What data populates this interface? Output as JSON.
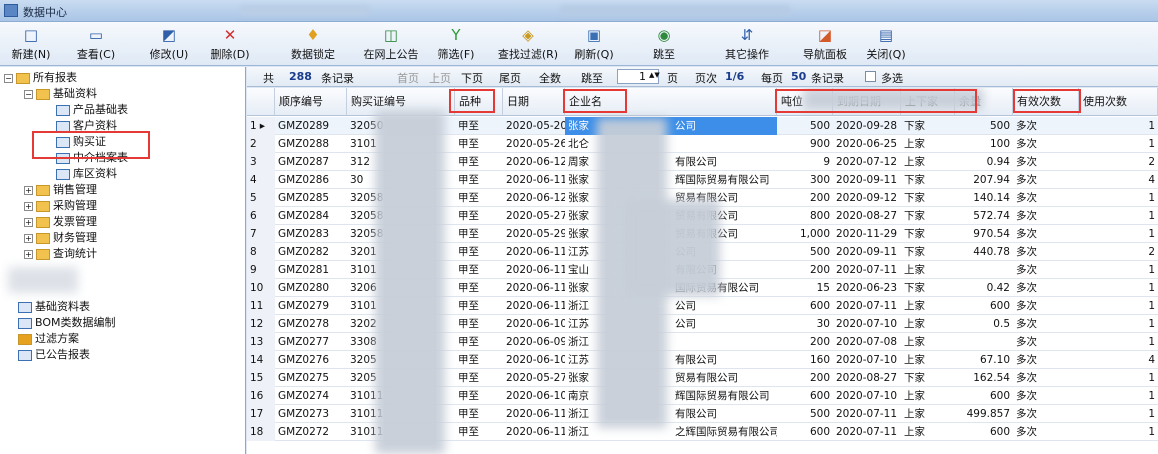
{
  "window": {
    "title": "数据中心"
  },
  "toolbar": [
    {
      "label": "新建(N)",
      "icon": "new-doc-icon",
      "glyph": "□",
      "color": "#2f5fa8"
    },
    {
      "label": "查看(C)",
      "icon": "view-icon",
      "glyph": "▭",
      "color": "#2f5fa8"
    },
    {
      "label": "修改(U)",
      "icon": "edit-icon",
      "glyph": "◩",
      "color": "#2f5fa8"
    },
    {
      "label": "删除(D)",
      "icon": "delete-icon",
      "glyph": "✕",
      "color": "#d32f2f"
    },
    {
      "label": "数据锁定",
      "icon": "lock-icon",
      "glyph": "♦",
      "color": "#e0a020"
    },
    {
      "label": "在网上公告",
      "icon": "publish-icon",
      "glyph": "◫",
      "color": "#2e8b3d"
    },
    {
      "label": "筛选(F)",
      "icon": "filter-icon",
      "glyph": "Y",
      "color": "#2e9b3a"
    },
    {
      "label": "查找过滤(R)",
      "icon": "search-filter-icon",
      "glyph": "◈",
      "color": "#c99a22"
    },
    {
      "label": "刷新(Q)",
      "icon": "refresh-icon",
      "glyph": "▣",
      "color": "#3a6fb4"
    },
    {
      "label": "跳至",
      "icon": "jump-icon",
      "glyph": "◉",
      "color": "#2e8b3d"
    },
    {
      "label": "其它操作",
      "icon": "other-ops-icon",
      "glyph": "⇵",
      "color": "#2f5fa8"
    },
    {
      "label": "导航面板",
      "icon": "nav-panel-icon",
      "glyph": "◪",
      "color": "#d35a2a"
    },
    {
      "label": "关闭(Q)",
      "icon": "close-icon",
      "glyph": "▤",
      "color": "#2f5fa8"
    }
  ],
  "tree": {
    "root": "所有报表",
    "basic": "基础资料",
    "basic_items": [
      "产品基础表",
      "客户资料",
      "购买证",
      "中介档案表",
      "库区资料"
    ],
    "groups": [
      "销售管理",
      "采购管理",
      "发票管理",
      "财务管理",
      "查询统计"
    ],
    "extra": [
      "基础资料表",
      "BOM类数据编制",
      "过滤方案",
      "已公告报表"
    ]
  },
  "grid_toolbar": {
    "count_prefix": "共",
    "count": "288",
    "count_suffix": "条记录",
    "first": "首页",
    "prev": "上页",
    "next": "下页",
    "last": "尾页",
    "all": "全数",
    "jump": "跳至",
    "page_input": "1",
    "page_unit": "页",
    "page_label": "页次",
    "page_value": "1/6",
    "per_page_prefix": "每页",
    "per_page": "50",
    "per_page_suffix": "条记录",
    "multi_select": "多选"
  },
  "grid": {
    "columns": [
      "",
      "顺序编号",
      "购买证编号",
      "品种",
      "日期",
      "企业名",
      "吨位",
      "到期日期",
      "上下家",
      "余量",
      "有效次数",
      "使用次数"
    ],
    "rows": [
      {
        "num": "1",
        "marker": "▸",
        "seq": "GMZ0289",
        "cert": "32050",
        "variety": "甲至",
        "date": "2020-05-20",
        "company": "张家",
        "tonnage": "500",
        "due": "2020-09-28",
        "updown": "下家",
        "remain": "500",
        "valid": "多次",
        "used": "1"
      },
      {
        "num": "2",
        "marker": "",
        "seq": "GMZ0288",
        "cert": "3101",
        "variety": "甲至",
        "date": "2020-05-26",
        "company": "北仑",
        "tonnage": "900",
        "due": "2020-06-25",
        "updown": "上家",
        "remain": "100",
        "valid": "多次",
        "used": "1"
      },
      {
        "num": "3",
        "marker": "",
        "seq": "GMZ0287",
        "cert": "312",
        "variety": "甲至",
        "date": "2020-06-12",
        "company": "周家",
        "tonnage": "9",
        "due": "2020-07-12",
        "updown": "上家",
        "remain": "0.94",
        "valid": "多次",
        "used": "2"
      },
      {
        "num": "4",
        "marker": "",
        "seq": "GMZ0286",
        "cert": "30",
        "variety": "甲至",
        "date": "2020-06-11",
        "company": "张家",
        "tonnage": "300",
        "due": "2020-09-11",
        "updown": "下家",
        "remain": "207.94",
        "valid": "多次",
        "used": "4"
      },
      {
        "num": "5",
        "marker": "",
        "seq": "GMZ0285",
        "cert": "32058",
        "variety": "甲至",
        "date": "2020-06-12",
        "company": "张家",
        "tonnage": "200",
        "due": "2020-09-12",
        "updown": "下家",
        "remain": "140.14",
        "valid": "多次",
        "used": "1"
      },
      {
        "num": "6",
        "marker": "",
        "seq": "GMZ0284",
        "cert": "32058",
        "variety": "甲至",
        "date": "2020-05-27",
        "company": "张家",
        "tonnage": "800",
        "due": "2020-08-27",
        "updown": "下家",
        "remain": "572.74",
        "valid": "多次",
        "used": "1"
      },
      {
        "num": "7",
        "marker": "",
        "seq": "GMZ0283",
        "cert": "32058",
        "variety": "甲至",
        "date": "2020-05-29",
        "company": "张家",
        "tonnage": "1,000",
        "due": "2020-11-29",
        "updown": "下家",
        "remain": "970.54",
        "valid": "多次",
        "used": "1"
      },
      {
        "num": "8",
        "marker": "",
        "seq": "GMZ0282",
        "cert": "3201",
        "variety": "甲至",
        "date": "2020-06-11",
        "company": "江苏",
        "tonnage": "500",
        "due": "2020-09-11",
        "updown": "下家",
        "remain": "440.78",
        "valid": "多次",
        "used": "2"
      },
      {
        "num": "9",
        "marker": "",
        "seq": "GMZ0281",
        "cert": "3101",
        "variety": "甲至",
        "date": "2020-06-11",
        "company": "宝山",
        "tonnage": "200",
        "due": "2020-07-11",
        "updown": "上家",
        "remain": "",
        "valid": "多次",
        "used": "1"
      },
      {
        "num": "10",
        "marker": "",
        "seq": "GMZ0280",
        "cert": "3206",
        "variety": "甲至",
        "date": "2020-06-11",
        "company": "张家",
        "tonnage": "15",
        "due": "2020-06-23",
        "updown": "下家",
        "remain": "0.42",
        "valid": "多次",
        "used": "1"
      },
      {
        "num": "11",
        "marker": "",
        "seq": "GMZ0279",
        "cert": "3101",
        "variety": "甲至",
        "date": "2020-06-11",
        "company": "浙江",
        "tonnage": "600",
        "due": "2020-07-11",
        "updown": "上家",
        "remain": "600",
        "valid": "多次",
        "used": "1"
      },
      {
        "num": "12",
        "marker": "",
        "seq": "GMZ0278",
        "cert": "3202",
        "variety": "甲至",
        "date": "2020-06-10",
        "company": "江苏",
        "tonnage": "30",
        "due": "2020-07-10",
        "updown": "上家",
        "remain": "0.5",
        "valid": "多次",
        "used": "1"
      },
      {
        "num": "13",
        "marker": "",
        "seq": "GMZ0277",
        "cert": "3308",
        "variety": "甲至",
        "date": "2020-06-09",
        "company": "浙江",
        "tonnage": "200",
        "due": "2020-07-08",
        "updown": "上家",
        "remain": "",
        "valid": "多次",
        "used": "1"
      },
      {
        "num": "14",
        "marker": "",
        "seq": "GMZ0276",
        "cert": "3205",
        "variety": "甲至",
        "date": "2020-06-10",
        "company": "江苏",
        "tonnage": "160",
        "due": "2020-07-10",
        "updown": "上家",
        "remain": "67.10",
        "valid": "多次",
        "used": "4"
      },
      {
        "num": "15",
        "marker": "",
        "seq": "GMZ0275",
        "cert": "3205",
        "variety": "甲至",
        "date": "2020-05-27",
        "company": "张家",
        "tonnage": "200",
        "due": "2020-08-27",
        "updown": "下家",
        "remain": "162.54",
        "valid": "多次",
        "used": "1"
      },
      {
        "num": "16",
        "marker": "",
        "seq": "GMZ0274",
        "cert": "31011",
        "variety": "甲至",
        "date": "2020-06-10",
        "company": "南京",
        "tonnage": "600",
        "due": "2020-07-10",
        "updown": "上家",
        "remain": "600",
        "valid": "多次",
        "used": "1"
      },
      {
        "num": "17",
        "marker": "",
        "seq": "GMZ0273",
        "cert": "31011",
        "variety": "甲至",
        "date": "2020-06-11",
        "company": "浙江",
        "tonnage": "500",
        "due": "2020-07-11",
        "updown": "上家",
        "remain": "499.857",
        "valid": "多次",
        "used": "1"
      },
      {
        "num": "18",
        "marker": "",
        "seq": "GMZ0272",
        "cert": "31011",
        "variety": "甲至",
        "date": "2020-06-11",
        "company": "浙江",
        "tonnage": "600",
        "due": "2020-07-11",
        "updown": "上家",
        "remain": "600",
        "valid": "多次",
        "used": "1"
      }
    ],
    "company_fragments": {
      "0": "公司",
      "2": "有限公司",
      "3": "辉国际贸易有限公司",
      "4": "贸易有限公司",
      "5": "贸易有限公司",
      "6": "贸易有限公司",
      "7": "公司",
      "8": "有限公司",
      "9": "国际贸易有限公司",
      "10": "公司",
      "11": "公司",
      "13": "有限公司",
      "14": "贸易有限公司",
      "15": "辉国际贸易有限公司",
      "16": "有限公司",
      "17": "之辉国际贸易有限公司"
    }
  },
  "colors": {
    "highlight": "#e53935",
    "selected": "#3c8ee8",
    "folder": "#f1c24e"
  }
}
